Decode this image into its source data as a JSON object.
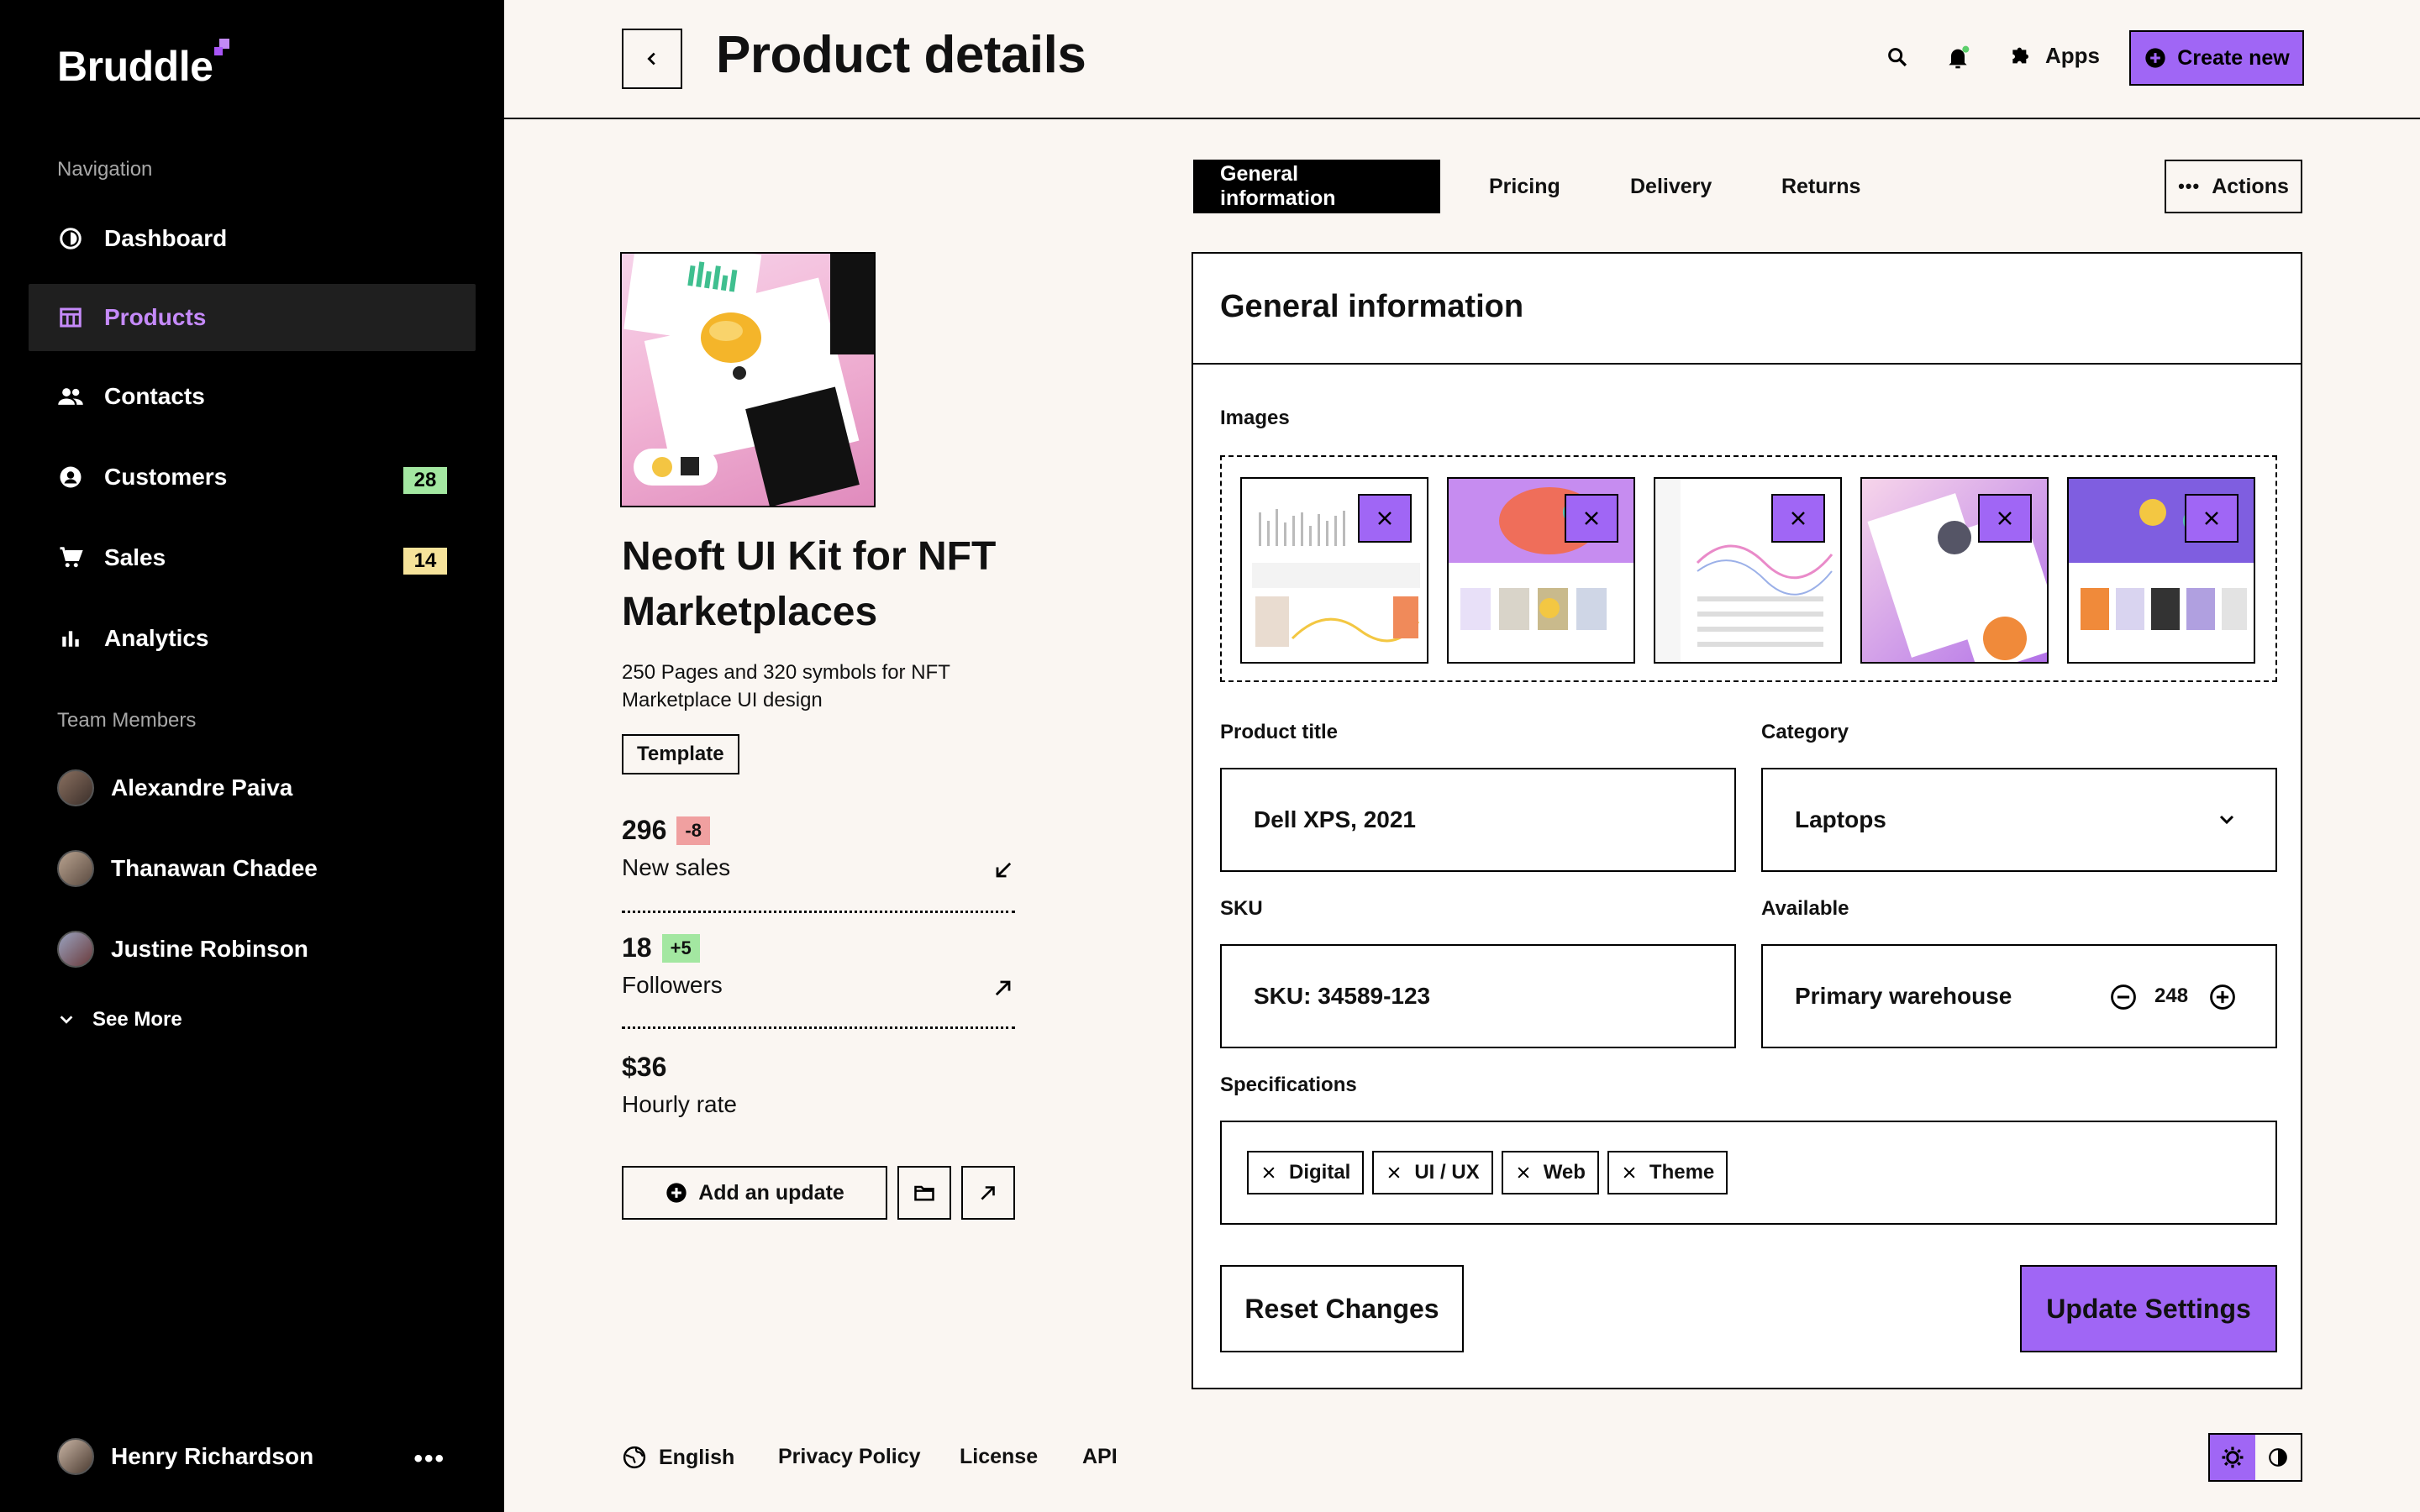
{
  "brand": {
    "name": "Bruddle"
  },
  "sidebar": {
    "nav_heading": "Navigation",
    "items": [
      {
        "label": "Dashboard",
        "icon": "dashboard-icon"
      },
      {
        "label": "Products",
        "icon": "products-icon",
        "active": true
      },
      {
        "label": "Contacts",
        "icon": "contacts-icon"
      },
      {
        "label": "Customers",
        "icon": "customers-icon",
        "badge": "28",
        "badge_color": "#a3e7a1"
      },
      {
        "label": "Sales",
        "icon": "cart-icon",
        "badge": "14",
        "badge_color": "#f6e39a"
      },
      {
        "label": "Analytics",
        "icon": "chart-icon"
      }
    ],
    "team_heading": "Team Members",
    "members": [
      "Alexandre Paiva",
      "Thanawan Chadee",
      "Justine Robinson"
    ],
    "see_more": "See More",
    "current_user": "Henry Richardson"
  },
  "header": {
    "title": "Product details",
    "apps_label": "Apps",
    "create_label": "Create new"
  },
  "product": {
    "name": "Neoft UI Kit for NFT Marketplaces",
    "description": "250 Pages and 320 symbols for NFT Marketplace UI design",
    "tag": "Template",
    "stats": [
      {
        "value": "296",
        "delta": "-8",
        "delta_color": "#f0a0a0",
        "label": "New sales",
        "trend": "down"
      },
      {
        "value": "18",
        "delta": "+5",
        "delta_color": "#a3e7a1",
        "label": "Followers",
        "trend": "up"
      },
      {
        "value": "$36",
        "label": "Hourly rate"
      }
    ],
    "add_update_label": "Add an update"
  },
  "tabs": [
    "General information",
    "Pricing",
    "Delivery",
    "Returns"
  ],
  "actions_label": "Actions",
  "card": {
    "title": "General information",
    "images_label": "Images",
    "product_title_label": "Product title",
    "product_title_value": "Dell XPS, 2021",
    "category_label": "Category",
    "category_value": "Laptops",
    "sku_label": "SKU",
    "sku_value": "SKU: 34589-123",
    "available_label": "Available",
    "warehouse_value": "Primary warehouse",
    "quantity": "248",
    "specs_label": "Specifications",
    "specs": [
      "Digital",
      "UI / UX",
      "Web",
      "Theme"
    ],
    "reset_label": "Reset Changes",
    "update_label": "Update Settings"
  },
  "footer": {
    "language": "English",
    "links": [
      "Privacy Policy",
      "License",
      "API"
    ]
  },
  "colors": {
    "accent": "#a066f5",
    "accent_text": "#c58af9",
    "sidebar_bg": "#000000",
    "page_bg": "#faf6f2"
  }
}
